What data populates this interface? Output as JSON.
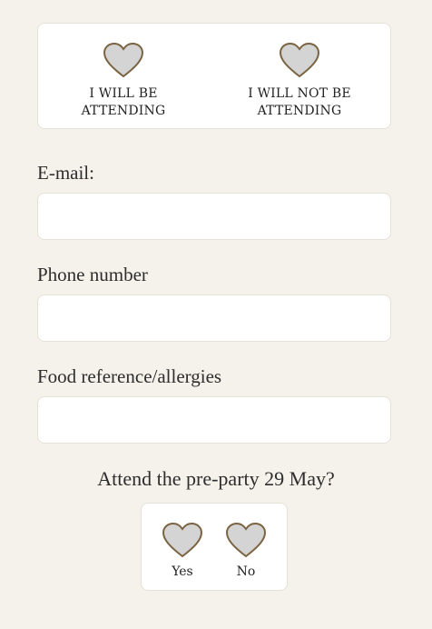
{
  "attendance": {
    "options": [
      {
        "line1": "I WILL BE",
        "line2": "ATTENDING"
      },
      {
        "line1": "I WILL NOT BE",
        "line2": "ATTENDING"
      }
    ]
  },
  "fields": {
    "email": {
      "label": "E-mail:",
      "value": "",
      "placeholder": ""
    },
    "phone": {
      "label": "Phone number",
      "value": "",
      "placeholder": ""
    },
    "food": {
      "label": "Food reference/allergies",
      "value": "",
      "placeholder": ""
    }
  },
  "preparty": {
    "question": "Attend the pre-party 29 May?",
    "yes_label": "Yes",
    "no_label": "No"
  },
  "colors": {
    "background": "#f5f2eb",
    "heart_fill": "#d4d4d4",
    "heart_stroke": "#7a6340"
  },
  "icons": [
    "heart-icon"
  ]
}
